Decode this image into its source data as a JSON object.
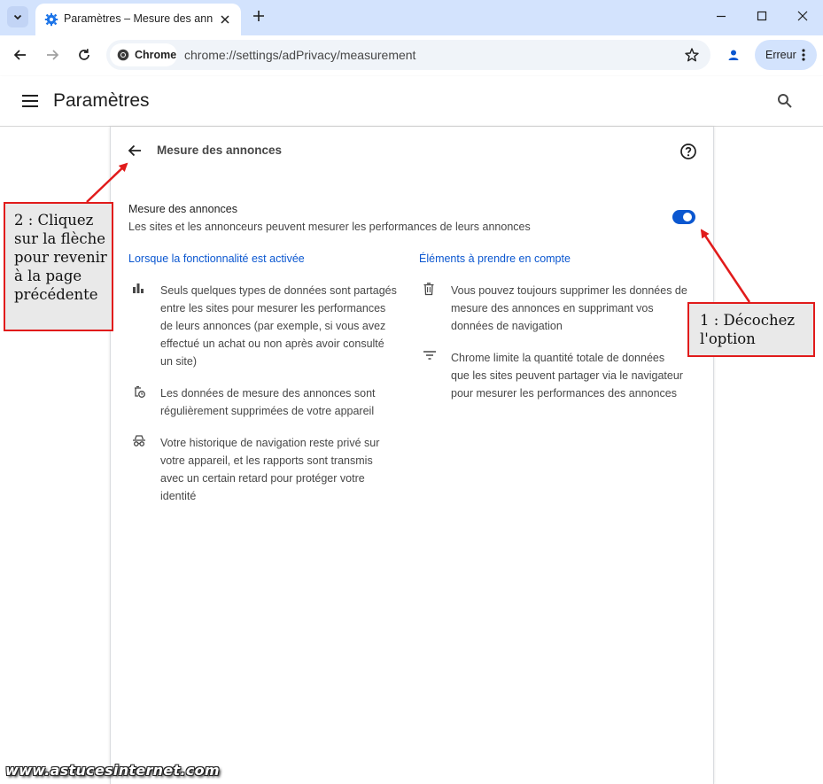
{
  "browser": {
    "tab_title": "Paramètres – Mesure des annonces",
    "address_chip": "Chrome",
    "url": "chrome://settings/adPrivacy/measurement",
    "profile_error": "Erreur"
  },
  "settings": {
    "header_title": "Paramètres",
    "subpage_title": "Mesure des annonces",
    "toggle": {
      "title": "Mesure des annonces",
      "description": "Les sites et les annonceurs peuvent mesurer les performances de leurs annonces",
      "enabled": true
    },
    "left_column": {
      "heading": "Lorsque la fonctionnalité est activée",
      "items": [
        {
          "icon": "bar-chart-icon",
          "lines": [
            "Seuls quelques types de données sont partagés",
            "entre les sites pour mesurer les performances",
            "de leurs annonces (par exemple, si vous avez",
            "effectué un achat ou non après avoir consulté",
            "un site)"
          ]
        },
        {
          "icon": "trash-clock-icon",
          "lines": [
            "Les données de mesure des annonces sont",
            "régulièrement supprimées de votre appareil"
          ]
        },
        {
          "icon": "incognito-icon",
          "lines": [
            "Votre historique de navigation reste privé sur",
            "votre appareil, et les rapports sont transmis",
            "avec un certain retard pour protéger votre",
            "identité"
          ]
        }
      ]
    },
    "right_column": {
      "heading": "Éléments à prendre en compte",
      "items": [
        {
          "icon": "trash-icon",
          "lines": [
            "Vous pouvez toujours supprimer les données de",
            "mesure des annonces en supprimant vos",
            "données de navigation"
          ]
        },
        {
          "icon": "filter-icon",
          "lines": [
            "Chrome limite la quantité totale de données",
            "que les sites peuvent partager via le navigateur",
            "pour mesurer les performances des annonces"
          ]
        }
      ]
    }
  },
  "annotations": {
    "step2": "2 : Cliquez sur la flèche pour revenir à la page précédente",
    "step1": "1 : Décochez l'option",
    "watermark": "www.astucesinternet.com"
  },
  "colors": {
    "accent": "#0b57d0",
    "annotation_red": "#e11b1b",
    "tabstrip": "#d3e3fd"
  }
}
